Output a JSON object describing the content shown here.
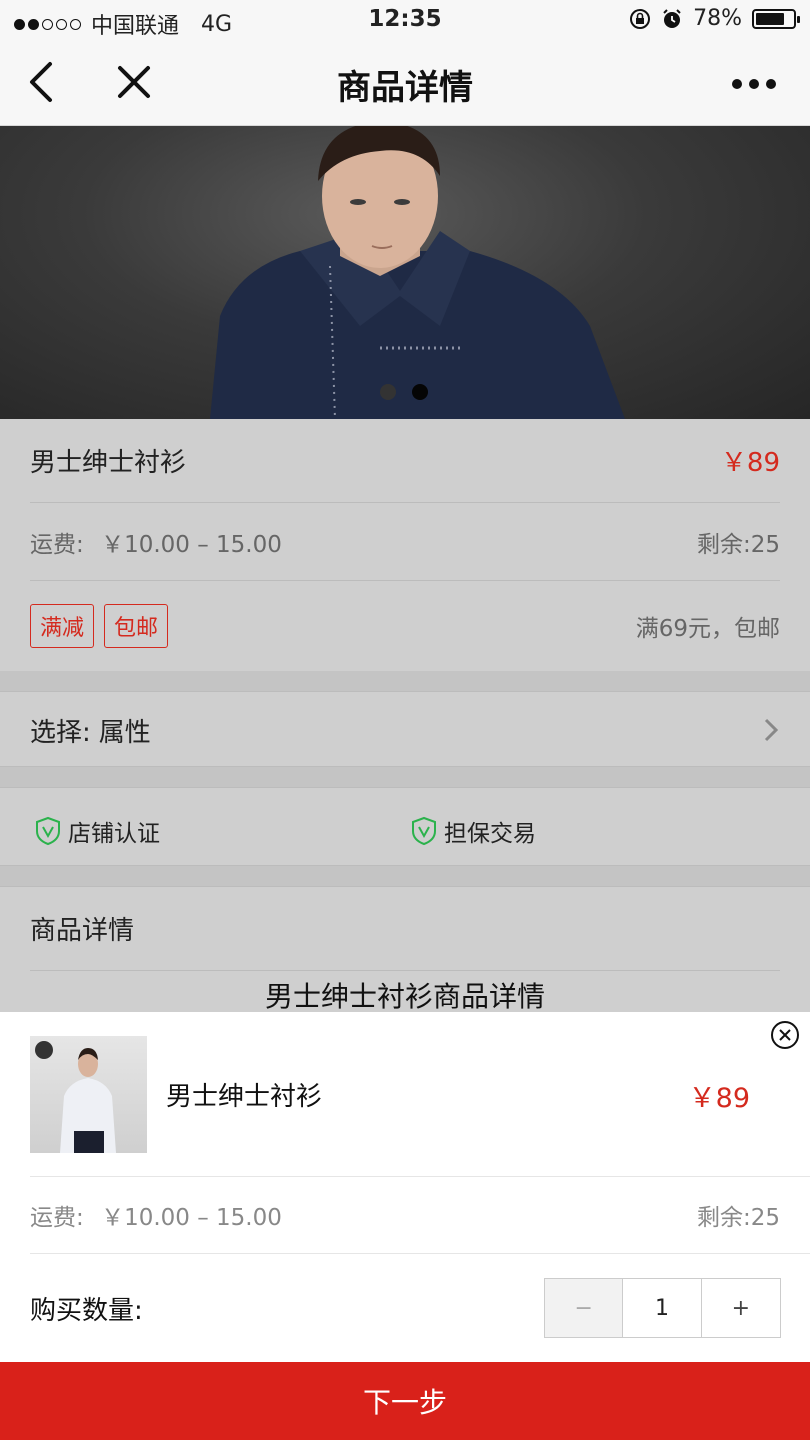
{
  "status_bar": {
    "carrier": "中国联通",
    "network": "4G",
    "time": "12:35",
    "battery": "78%",
    "battery_level": 0.78
  },
  "nav": {
    "title": "商品详情"
  },
  "product": {
    "name": "男士绅士衬衫",
    "price": "￥89",
    "shipping_label": "运费:",
    "shipping_value": "￥10.00 – 15.00",
    "stock": "剩余:25",
    "tags": [
      "满减",
      "包邮"
    ],
    "promo_text": "满69元，包邮"
  },
  "select": {
    "label": "选择:",
    "value": "属性"
  },
  "badges": [
    "店铺认证",
    "担保交易"
  ],
  "details": {
    "heading": "商品详情",
    "subtitle": "男士绅士衬衫商品详情"
  },
  "sheet": {
    "name": "男士绅士衬衫",
    "price": "￥89",
    "shipping_label": "运费:",
    "shipping_value": "￥10.00 – 15.00",
    "stock": "剩余:25",
    "qty_label": "购买数量:",
    "minus": "−",
    "quantity": "1",
    "plus": "+"
  },
  "footer": {
    "next_label": "下一步"
  },
  "colors": {
    "accent": "#d9211a",
    "price": "#d42a1e",
    "badge_green": "#2bb24c"
  }
}
